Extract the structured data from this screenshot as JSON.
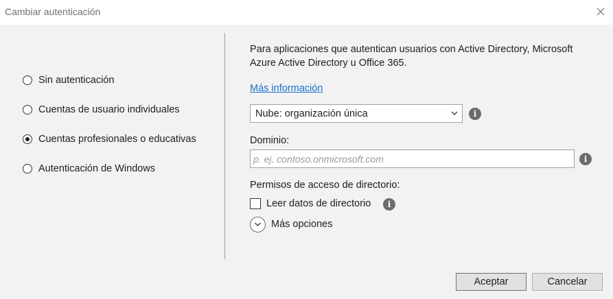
{
  "window": {
    "title": "Cambiar autenticación",
    "close_icon": "close-icon"
  },
  "auth_options": [
    {
      "label": "Sin autenticación",
      "selected": false
    },
    {
      "label": "Cuentas de usuario individuales",
      "selected": false
    },
    {
      "label": "Cuentas profesionales o educativas",
      "selected": true
    },
    {
      "label": "Autenticación de Windows",
      "selected": false
    }
  ],
  "details": {
    "description": "Para aplicaciones que autentican usuarios con Active Directory, Microsoft Azure Active Directory u Office 365.",
    "more_info_link": "Más información",
    "tenant_select": {
      "value": "Nube: organización única"
    },
    "domain": {
      "label": "Dominio:",
      "value": "",
      "placeholder": "p. ej. contoso.onmicrosoft.com"
    },
    "permissions": {
      "label": "Permisos de acceso de directorio:",
      "read_directory_label": "Leer datos de directorio",
      "read_directory_checked": false
    },
    "more_options_label": "Más opciones"
  },
  "footer": {
    "accept_label": "Aceptar",
    "cancel_label": "Cancelar"
  },
  "colors": {
    "link": "#1a6fc9",
    "panel_background": "#f2f2f2",
    "title_background": "#ffffff",
    "info_icon": "#6b6b6b"
  }
}
